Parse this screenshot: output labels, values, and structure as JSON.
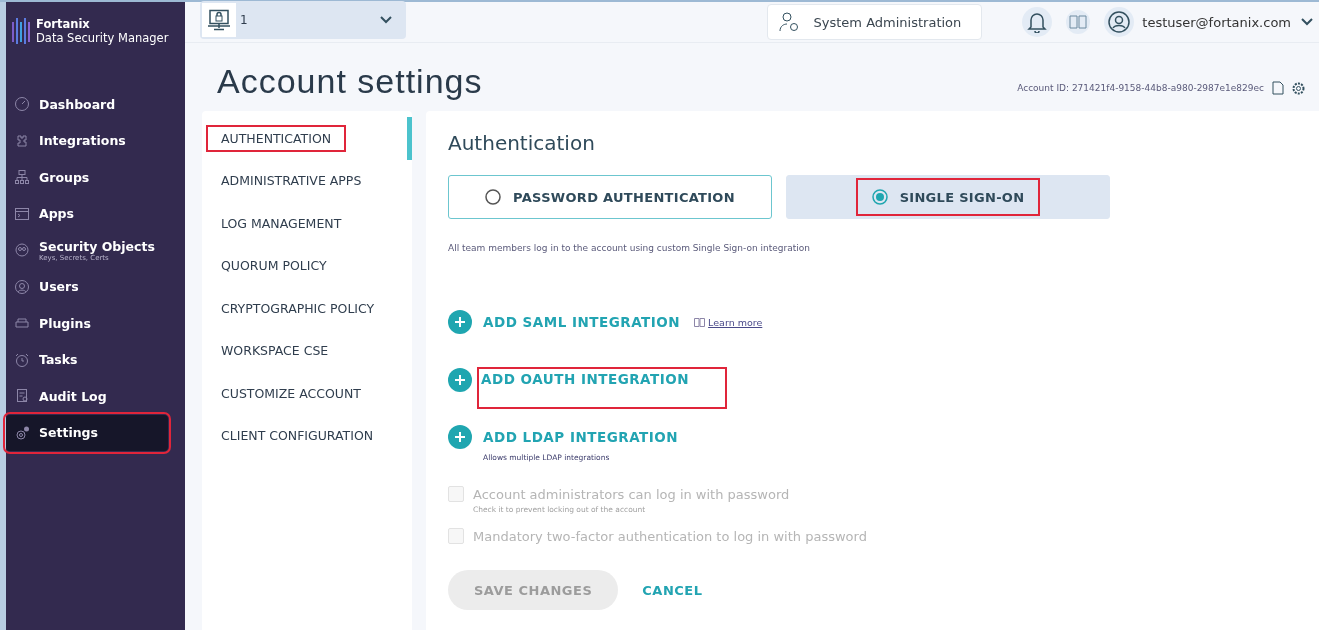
{
  "sidebar": {
    "brand": {
      "name": "Fortanix",
      "product": "Data Security Manager"
    },
    "items": [
      {
        "label": "Dashboard",
        "selected": false,
        "highlighted": false
      },
      {
        "label": "Integrations",
        "selected": false,
        "highlighted": false
      },
      {
        "label": "Groups",
        "selected": false,
        "highlighted": false
      },
      {
        "label": "Apps",
        "selected": false,
        "highlighted": false
      },
      {
        "label": "Security Objects",
        "sublabel": "Keys, Secrets, Certs",
        "selected": false,
        "highlighted": false
      },
      {
        "label": "Users",
        "selected": false,
        "highlighted": false
      },
      {
        "label": "Plugins",
        "selected": false,
        "highlighted": false
      },
      {
        "label": "Tasks",
        "selected": false,
        "highlighted": false
      },
      {
        "label": "Audit Log",
        "selected": false,
        "highlighted": false
      },
      {
        "label": "Settings",
        "selected": true,
        "highlighted": true
      }
    ]
  },
  "topbar": {
    "account_selector": {
      "value": "1"
    },
    "admin_button": {
      "label": "System Administration"
    },
    "user": {
      "email": "testuser@fortanix.com"
    }
  },
  "page": {
    "title": "Account settings",
    "account_id": "Account ID: 271421f4-9158-44b8-a980-2987e1e829ec"
  },
  "settings_menu": {
    "items": [
      {
        "label": "AUTHENTICATION",
        "selected": true,
        "highlighted": true
      },
      {
        "label": "ADMINISTRATIVE APPS",
        "selected": false,
        "highlighted": false
      },
      {
        "label": "LOG MANAGEMENT",
        "selected": false,
        "highlighted": false
      },
      {
        "label": "QUORUM POLICY",
        "selected": false,
        "highlighted": false
      },
      {
        "label": "CRYPTOGRAPHIC POLICY",
        "selected": false,
        "highlighted": false
      },
      {
        "label": "WORKSPACE CSE",
        "selected": false,
        "highlighted": false
      },
      {
        "label": "CUSTOMIZE ACCOUNT",
        "selected": false,
        "highlighted": false
      },
      {
        "label": "CLIENT CONFIGURATION",
        "selected": false,
        "highlighted": false
      }
    ]
  },
  "panel": {
    "title": "Authentication",
    "auth_options": [
      {
        "label": "PASSWORD AUTHENTICATION",
        "selected": false,
        "highlighted": false
      },
      {
        "label": "SINGLE SIGN-ON",
        "selected": true,
        "highlighted": true
      }
    ],
    "description": "All team members log in to the account using custom Single Sign-on integration",
    "integrations": [
      {
        "label": "ADD SAML INTEGRATION",
        "link": "Learn more",
        "highlighted": false
      },
      {
        "label": "ADD OAUTH INTEGRATION",
        "highlighted": true
      },
      {
        "label": "ADD LDAP INTEGRATION",
        "note": "Allows multiple LDAP integrations",
        "highlighted": false
      }
    ],
    "checkboxes": [
      {
        "label": "Account administrators can log in with password",
        "hint": "Check it to prevent locking out of the account",
        "checked": false,
        "disabled": true
      },
      {
        "label": "Mandatory two-factor authentication to log in with password",
        "checked": false,
        "disabled": true
      }
    ],
    "buttons": [
      {
        "label": "SAVE CHANGES",
        "kind": "primary",
        "disabled": true
      },
      {
        "label": "CANCEL",
        "kind": "link",
        "disabled": false
      }
    ]
  }
}
